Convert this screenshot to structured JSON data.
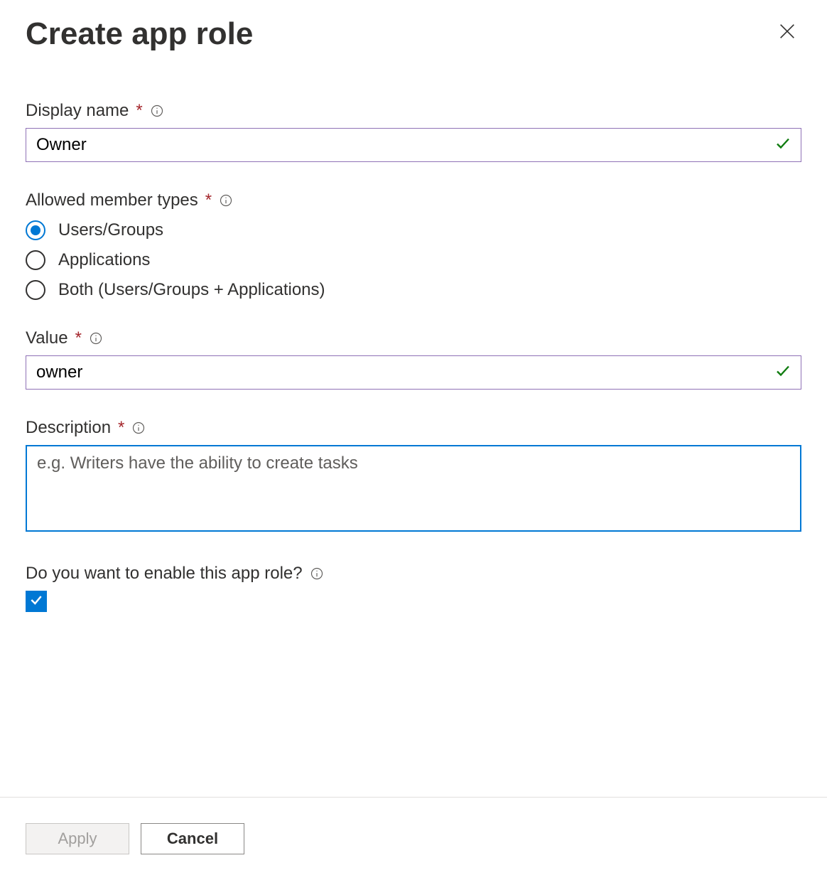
{
  "header": {
    "title": "Create app role"
  },
  "fields": {
    "displayName": {
      "label": "Display name",
      "value": "Owner"
    },
    "memberTypes": {
      "label": "Allowed member types",
      "options": [
        "Users/Groups",
        "Applications",
        "Both (Users/Groups + Applications)"
      ],
      "selected": 0
    },
    "value": {
      "label": "Value",
      "value": "owner"
    },
    "description": {
      "label": "Description",
      "value": "",
      "placeholder": "e.g. Writers have the ability to create tasks"
    },
    "enable": {
      "label": "Do you want to enable this app role?",
      "checked": true
    }
  },
  "footer": {
    "apply": "Apply",
    "cancel": "Cancel"
  }
}
